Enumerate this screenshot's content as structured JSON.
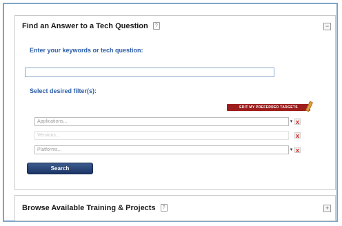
{
  "find_panel": {
    "title": "Find an Answer to a Tech Question",
    "toggle": "−",
    "keyword_label": "Enter your keywords or tech question:",
    "keyword_value": "",
    "filter_label": "Select desired filter(s):",
    "edit_preferences_label": "EDIT MY PREFERRED TARGETS",
    "filters": {
      "applications": {
        "placeholder": "Applications...",
        "remove": "x"
      },
      "versions": {
        "placeholder": "Versions...",
        "remove": "x"
      },
      "platforms": {
        "placeholder": "Platforms...",
        "remove": "x"
      }
    },
    "search_label": "Search"
  },
  "browse_panel": {
    "title": "Browse Available Training & Projects",
    "toggle": "+"
  },
  "help_glyph": "?",
  "arrow_glyph": "▾",
  "colors": {
    "frame_border": "#7ea4c6",
    "label_blue": "#2b5da8",
    "search_button": "#1b3566",
    "edit_badge": "#9e1d1d",
    "remove_red": "#c81e1e"
  }
}
